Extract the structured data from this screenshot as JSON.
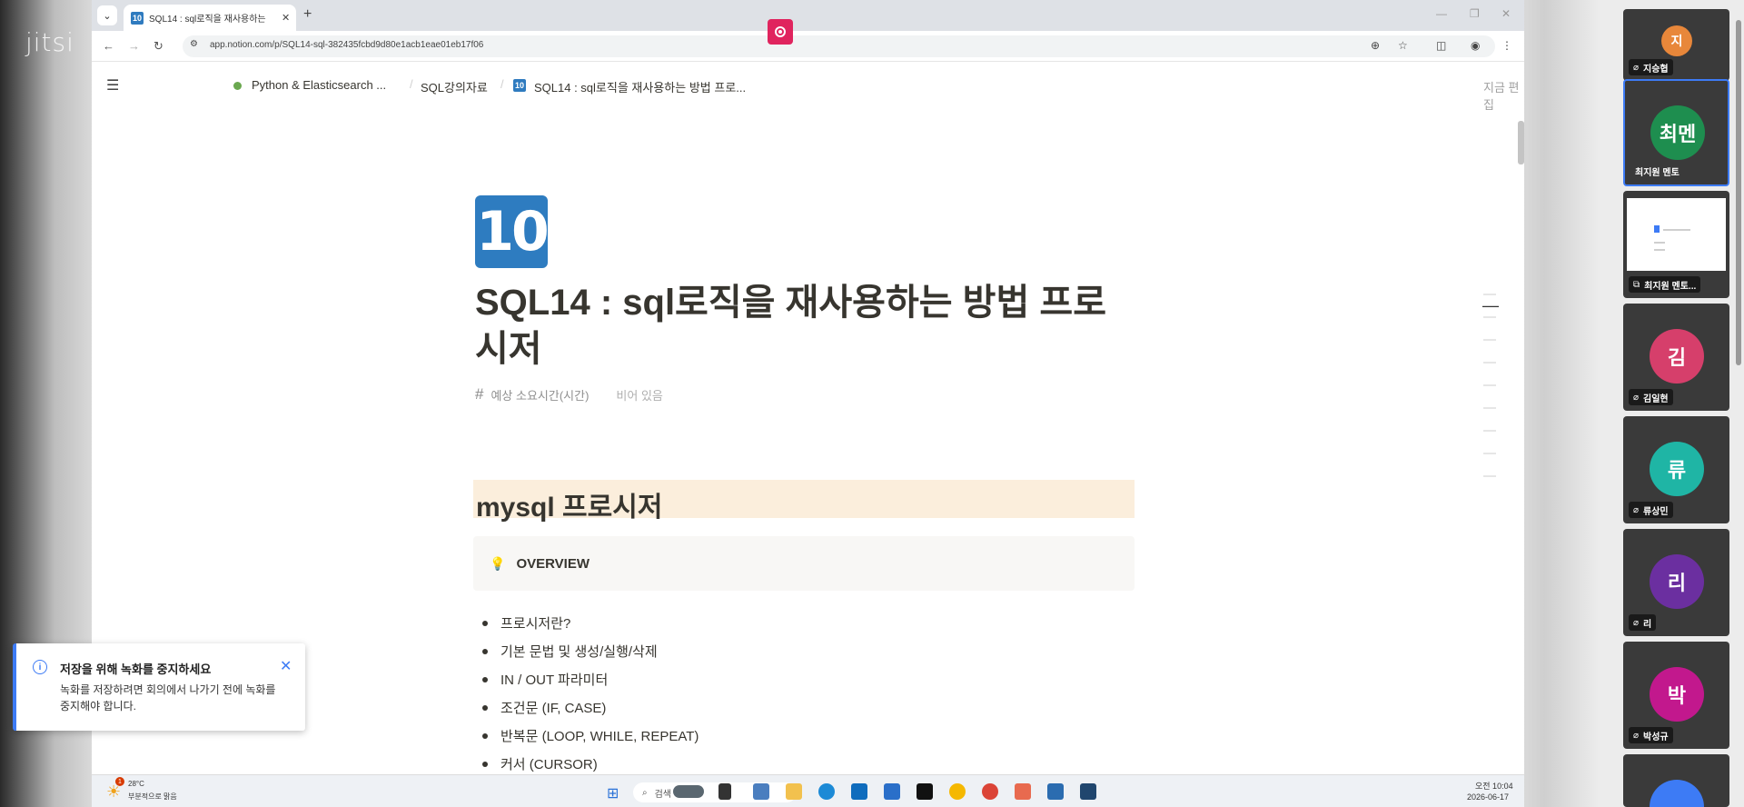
{
  "app": {
    "logo_text": "jitsi"
  },
  "browser": {
    "tab_title": "SQL14 : sql로직을 재사용하는",
    "tab_icon_text": "10",
    "url": "app.notion.com/p/SQL14-sql-382435fcbd9d80e1acb1eae01eb17f06"
  },
  "notion": {
    "breadcrumbs": [
      "Python & Elasticsearch ...",
      "SQL강의자료",
      "SQL14 : sql로직을 재사용하는 방법 프로..."
    ],
    "edit_label": "지금 편집",
    "page_icon": "10",
    "page_title": "SQL14 : sql로직을 재사용하는 방법 프로시저",
    "property_name": "예상 소요시간(시간)",
    "property_value": "비어 있음",
    "heading": "mysql 프로시저",
    "callout_title": "OVERVIEW",
    "bullets": [
      "프로시저란?",
      "기본 문법 및 생성/실행/삭제",
      "IN / OUT 파라미터",
      "조건문 (IF, CASE)",
      "반복문 (LOOP, WHILE, REPEAT)",
      "커서 (CURSOR)"
    ]
  },
  "taskbar": {
    "weather_temp": "28°C",
    "weather_desc": "부분적으로 맑음",
    "weather_badge": "1",
    "search_label": "검색",
    "time": "오전 10:04",
    "date": "2026-06-17"
  },
  "toast": {
    "title": "저장을 위해 녹화를 중지하세요",
    "body": "녹화를 저장하려면 회의에서 나가기 전에 녹화를 중지해야 합니다."
  },
  "participants": [
    {
      "initials": "지",
      "name": "지승협",
      "color": "#e8873a"
    },
    {
      "initials": "최멘",
      "name": "최지원 멘토",
      "color": "#1e8e4f"
    },
    {
      "initials": "",
      "name": "최지원 멘토...",
      "color": ""
    },
    {
      "initials": "김",
      "name": "김일현",
      "color": "#d63f6b"
    },
    {
      "initials": "류",
      "name": "류상민",
      "color": "#1fb5a5"
    },
    {
      "initials": "리",
      "name": "리",
      "color": "#6b2fa0"
    },
    {
      "initials": "박",
      "name": "박성규",
      "color": "#c2188d"
    }
  ]
}
